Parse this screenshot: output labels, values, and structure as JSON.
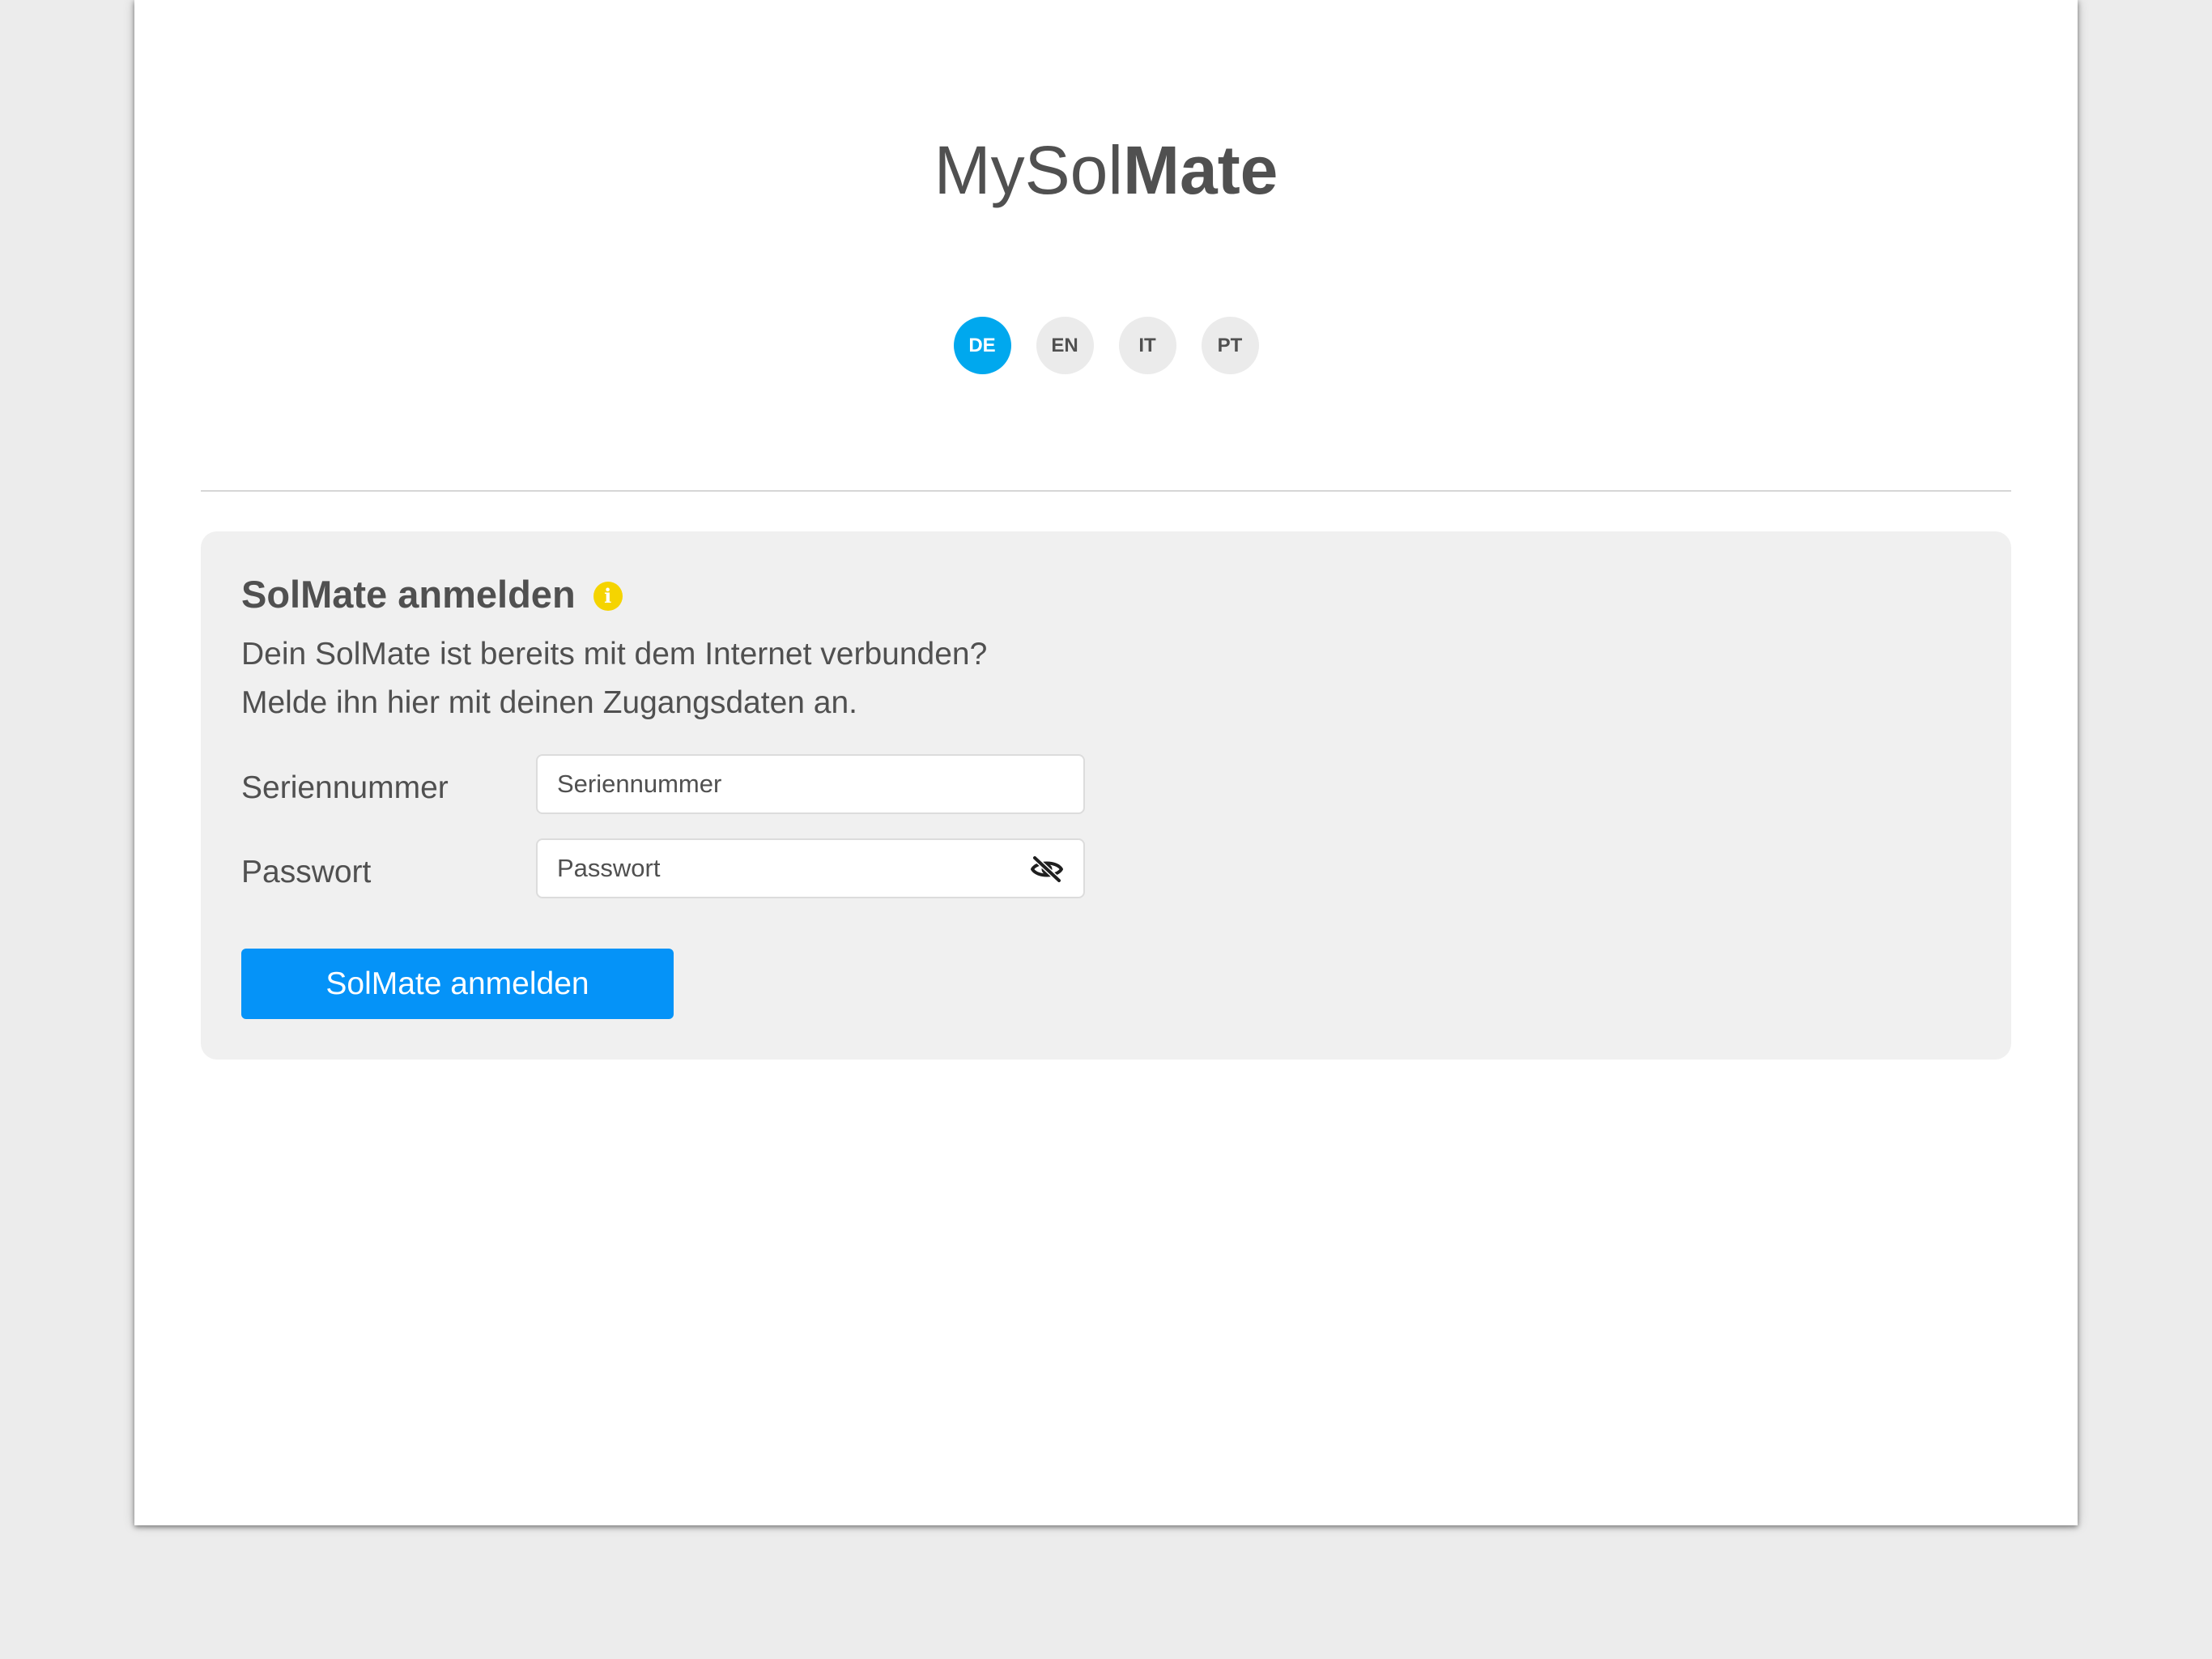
{
  "app": {
    "logo_light": "MySol",
    "logo_bold": "Mate"
  },
  "languages": [
    {
      "code": "DE",
      "active": true
    },
    {
      "code": "EN",
      "active": false
    },
    {
      "code": "IT",
      "active": false
    },
    {
      "code": "PT",
      "active": false
    }
  ],
  "login": {
    "title": "SolMate anmelden",
    "info_icon": "info-icon",
    "description_line1": "Dein SolMate ist bereits mit dem Internet verbunden?",
    "description_line2": "Melde ihn hier mit deinen Zugangsdaten an.",
    "serial_label": "Seriennummer",
    "serial_placeholder": "Seriennummer",
    "serial_value": "",
    "password_label": "Passwort",
    "password_placeholder": "Passwort",
    "password_value": "",
    "password_toggle_icon": "eye-slash-icon",
    "submit_label": "SolMate anmelden"
  },
  "colors": {
    "accent": "#00a8ee",
    "button": "#0593f8",
    "info": "#f5d400",
    "text": "#505050",
    "card": "#f0f0f0"
  }
}
